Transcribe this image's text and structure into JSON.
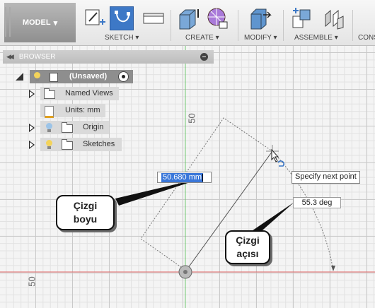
{
  "toolbar": {
    "model_label": "MODEL",
    "groups": {
      "sketch": "SKETCH",
      "create": "CREATE",
      "modify": "MODIFY",
      "assemble": "ASSEMBLE",
      "construct": "CONS"
    }
  },
  "browser": {
    "title": "BROWSER",
    "root": "(Unsaved)",
    "items": [
      {
        "label": "Named Views"
      },
      {
        "label": "Units: mm"
      },
      {
        "label": "Origin"
      },
      {
        "label": "Sketches"
      }
    ]
  },
  "canvas": {
    "length_value": "50.680 mm",
    "angle_value": "55.3 deg",
    "tooltip": "Specify next point",
    "ruler_top": "50",
    "ruler_left": "50"
  },
  "callouts": {
    "length": [
      "Çizgi",
      "boyu"
    ],
    "angle": [
      "Çizgi",
      "açısı"
    ]
  },
  "colors": {
    "accent": "#3d78c6",
    "selection": "#3a77d9"
  }
}
